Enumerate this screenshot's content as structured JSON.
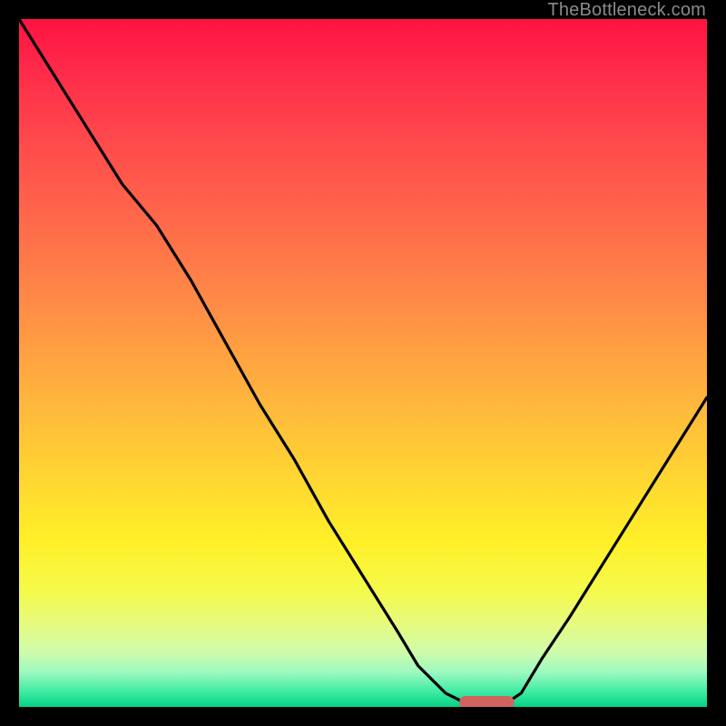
{
  "watermark": "TheBottleneck.com",
  "colors": {
    "page_bg": "#000000",
    "curve_stroke": "#000000",
    "marker_fill": "#d0635e",
    "marker_stroke": "#d0635e"
  },
  "chart_data": {
    "type": "line",
    "title": "",
    "xlabel": "",
    "ylabel": "",
    "xlim": [
      0,
      100
    ],
    "ylim": [
      0,
      100
    ],
    "series": [
      {
        "name": "bottleneck-curve",
        "x": [
          0,
          5,
          10,
          15,
          20,
          25,
          30,
          35,
          40,
          45,
          50,
          55,
          58,
          62,
          66,
          70,
          73,
          76,
          80,
          85,
          90,
          95,
          100
        ],
        "values": [
          100,
          92,
          84,
          76,
          70,
          62,
          53,
          44,
          36,
          27,
          19,
          11,
          6,
          2,
          0,
          0,
          2,
          7,
          13,
          21,
          29,
          37,
          45
        ]
      }
    ],
    "marker": {
      "x_start": 64,
      "x_end": 72,
      "y": 0
    }
  }
}
